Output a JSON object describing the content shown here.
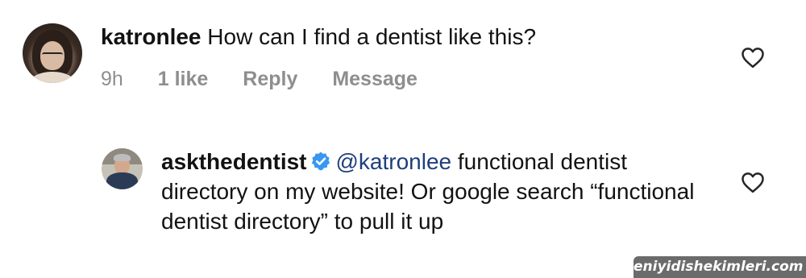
{
  "comments": [
    {
      "username": "katronlee",
      "text": "How can I find a dentist like this?",
      "time": "9h",
      "likes": "1 like",
      "reply_label": "Reply",
      "message_label": "Message"
    }
  ],
  "reply": {
    "username": "askthedentist",
    "verified": true,
    "mention": "@katronlee",
    "text": "functional dentist directory on my website! Or google search “functional dentist directory” to pull it up"
  },
  "watermark": "eniyidishekimleri.com",
  "icons": {
    "like": "heart-outline-icon",
    "verified": "verified-badge-icon"
  },
  "colors": {
    "text": "#121212",
    "meta": "#8e8e8e",
    "mention": "#1f3e7a",
    "verified": "#3897f0"
  }
}
